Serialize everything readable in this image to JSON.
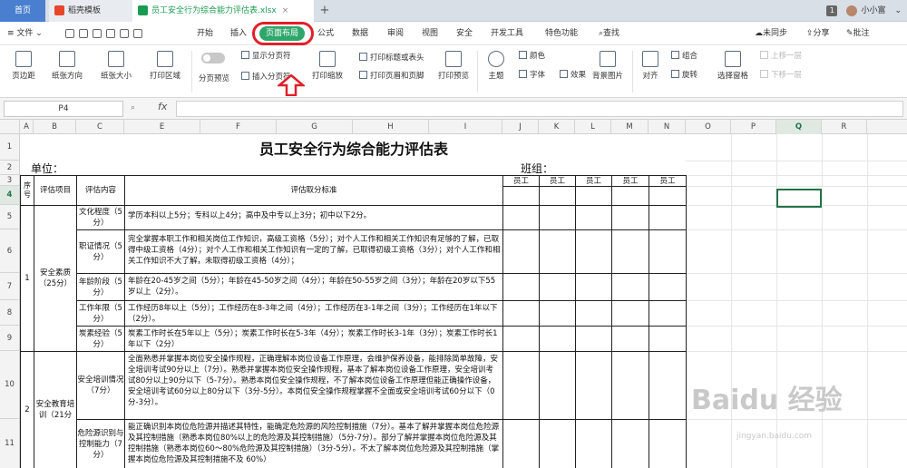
{
  "tabs": {
    "home": "首页",
    "template": "稻壳模板",
    "file": "员工安全行为综合能力评估表.xlsx",
    "add": "+"
  },
  "window": {
    "badge": "1",
    "user": "小小富"
  },
  "menu": {
    "file": "文件",
    "items": [
      "开始",
      "插入",
      "页面布局",
      "公式",
      "数据",
      "审阅",
      "视图",
      "安全",
      "开发工具",
      "特色功能"
    ],
    "search": "查找",
    "right": [
      "未同步",
      "分享",
      "批注"
    ]
  },
  "ribbon": {
    "margins": "页边距",
    "orientation": "纸张方向",
    "size": "纸张大小",
    "print_area": "打印区域",
    "page_preview": "分页预览",
    "show_breaks": "显示分页符",
    "insert_break": "插入分页符",
    "print_scale": "打印缩放",
    "print_titles": "打印标题或表头",
    "print_header_footer": "打印页眉和页脚",
    "print_preview": "打印预览",
    "theme": "主题",
    "colors": "颜色",
    "fonts": "字体",
    "effects": "效果",
    "background": "背景图片",
    "align": "对齐",
    "group": "组合",
    "rotate": "旋转",
    "selection_pane": "选择窗格",
    "bring_forward": "上移一层",
    "send_backward": "下移一层"
  },
  "formula": {
    "namebox": "P4",
    "fx": "fx",
    "value": ""
  },
  "columns": [
    "A",
    "B",
    "C",
    "E",
    "F",
    "G",
    "H",
    "I",
    "J",
    "K",
    "L",
    "M",
    "N",
    "O",
    "P",
    "Q",
    "R"
  ],
  "rows": [
    "1",
    "2",
    "3",
    "4",
    "5",
    "6",
    "7",
    "8",
    "9",
    "10",
    "11"
  ],
  "sheet": {
    "title": "员工安全行为综合能力评估表",
    "unit_label": "单位：",
    "team_label": "班组：",
    "headers": {
      "no": "序号",
      "item": "评估项目",
      "content": "评估内容",
      "standard": "评估取分标准",
      "employee": "员工"
    },
    "cat1": {
      "no": "1",
      "name": "安全素质（25分）"
    },
    "cat2": {
      "no": "2",
      "name": "安全教育培训（21分"
    },
    "r5": {
      "content": "文化程度（5分）",
      "standard": "学历本科以上5分；专科以上4分；高中及中专以上3分；初中以下2分。"
    },
    "r6": {
      "content": "职证情况（5分）",
      "standard": "完全掌握本职工作和相关岗位工作知识，高级工资格（5分）；对个人工作和相关工作知识有足够的了解，已取得中级工资格（4分）；对个人工作和相关工作知识有一定的了解，已取得初级工资格（3分）；对个人工作和相关工作知识不大了解，未取得初级工资格（4分）；"
    },
    "r7": {
      "content": "年龄阶段（5分）",
      "standard": "年龄在20-45岁之间（5分）；年龄在45-50岁之间（4分）；年龄在50-55岁之间（3分）；年龄在20岁以下55岁以上（2分）。"
    },
    "r8": {
      "content": "工作年限（5分）",
      "standard": "工作经历8年以上（5分）；工作经历在8-3年之间（4分）；工作经历在3-1年之间（3分）；工作经历在1年以下（2分）。"
    },
    "r9": {
      "content": "炭素经验（5分）",
      "standard": "炭素工作时长在5年以上（5分）；炭素工作时长在5-3年（4分）；炭素工作时长3-1年（3分）；炭素工作时长1年以下（2分）"
    },
    "r10": {
      "content": "安全培训情况（7分）",
      "standard": "全面熟悉并掌握本岗位安全操作规程，正确理解本岗位设备工作原理，会维护保养设备，能排除简单故障，安全培训考试90分以上（7分）。熟悉并掌握本岗位安全操作规程，基本了解本岗位设备工作原理，安全培训考试80分以上90分以下（5-7分）。熟悉本岗位安全操作规程，不了解本岗位设备工作原理但能正确操作设备，安全培训考试60分以上80分以下（3分-5分）。本岗位安全操作规程掌握不全面或安全培训考试60分以下（0分-3分）。"
    },
    "r11": {
      "content": "危险源识别与控制能力（7分）",
      "standard": "能正确识别本岗位危险源并描述其特性，能确定危险源的风险控制措施（7分）。基本了解并掌握本岗位危险源及其控制措施（熟悉本岗位80%以上的危险源及其控制措施）（5分-7分）。部分了解并掌握本岗位危险源及其控制措施（熟悉本岗位60～80%危险源及其控制措施）（3分-5分）。不太了解本岗位危险源及其控制措施（掌握本岗位危险源及其控制措施不及 60%）"
    }
  },
  "watermark": {
    "main": "Baidu 经验",
    "sub": "jingyan.baidu.com"
  },
  "colors": {
    "accent": "#2ea76a",
    "highlight_ring": "#e0202a",
    "tab_home": "#4a7fcf",
    "selection": "#217346"
  }
}
